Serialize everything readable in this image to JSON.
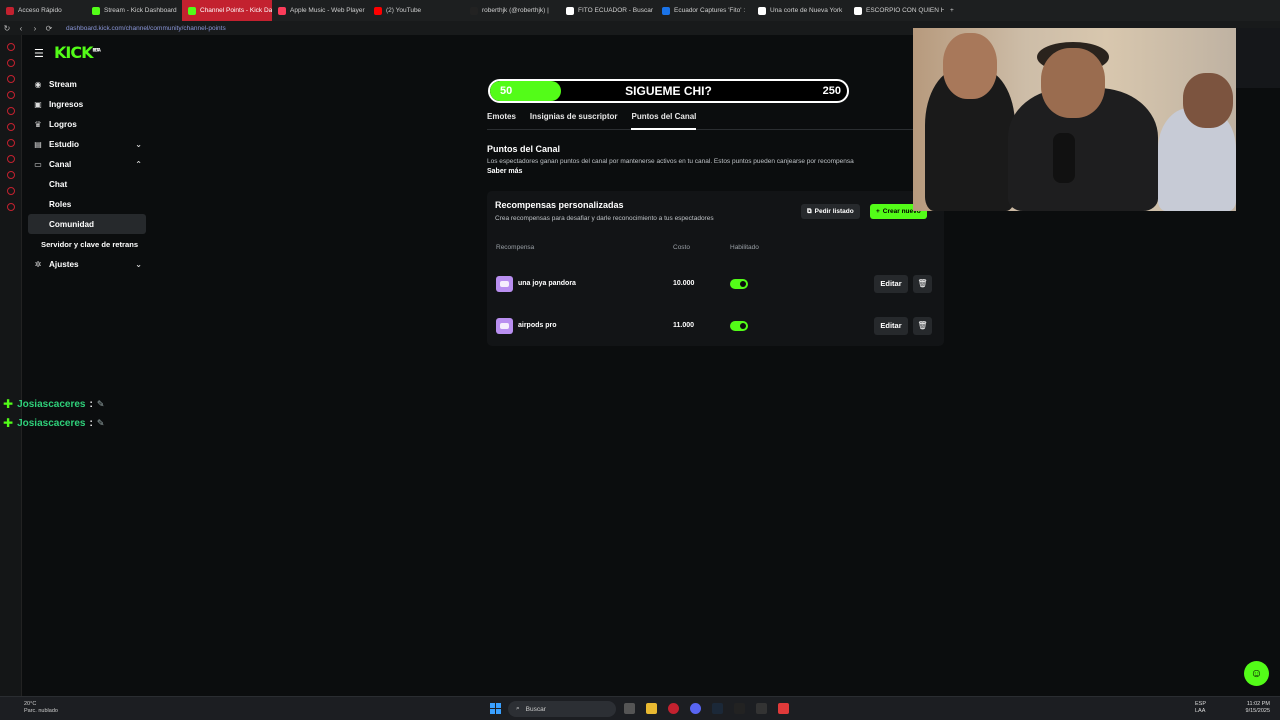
{
  "browser": {
    "tabs": [
      {
        "label": "Acceso Rápido",
        "color": "#c3212f"
      },
      {
        "label": "Stream - Kick Dashboard",
        "color": "#53fc18"
      },
      {
        "label": "Channel Points - Kick Da",
        "color": "#53fc18",
        "active": true
      },
      {
        "label": "Apple Music - Web Player",
        "color": "#fa3c5a"
      },
      {
        "label": "(2) YouTube",
        "color": "#ff0000"
      },
      {
        "label": "roberthjk (@roberthjk) |",
        "color": "#222"
      },
      {
        "label": "FITO ECUADOR - Buscar",
        "color": "#ffffff"
      },
      {
        "label": "Ecuador Captures 'Fito' :",
        "color": "#1a73e8"
      },
      {
        "label": "Una corte de Nueva York",
        "color": "#ffffff"
      },
      {
        "label": "ESCORPIO CON QUIEN H",
        "color": "#ffffff"
      }
    ],
    "url": "dashboard.kick.com/channel/community/channel-points"
  },
  "sidebar": {
    "logo": "KICK",
    "logo_badge": "BETA",
    "items": [
      {
        "label": "Stream",
        "icon": "stream-icon"
      },
      {
        "label": "Ingresos",
        "icon": "income-icon"
      },
      {
        "label": "Logros",
        "icon": "trophy-icon"
      },
      {
        "label": "Estudio",
        "icon": "studio-icon"
      },
      {
        "label": "Canal",
        "icon": "channel-icon"
      },
      {
        "label": "Chat"
      },
      {
        "label": "Roles"
      },
      {
        "label": "Comunidad"
      },
      {
        "label": "Servidor y clave de retrans"
      },
      {
        "label": "Ajustes",
        "icon": "gear-icon"
      }
    ]
  },
  "chat_overlay": [
    {
      "user": "Josiascaceres",
      "sep": ":"
    },
    {
      "user": "Josiascaceres",
      "sep": ":"
    }
  ],
  "goal": {
    "left_value": "50",
    "title": "SIGUEME CHI?",
    "right_value": "250",
    "progress": 0.2
  },
  "page": {
    "tabs": [
      "Emotes",
      "Insignias de suscriptor",
      "Puntos del Canal"
    ],
    "section_title": "Puntos del Canal",
    "section_desc": "Los espectadores ganan puntos del canal por mantenerse activos en tu canal. Estos puntos pueden canjearse por recompensa",
    "learn_more": "Saber más",
    "card": {
      "title": "Recompensas personalizadas",
      "desc": "Crea recompensas para desafiar y darle reconocimiento a tus espectadores",
      "list_button": "Pedir listado",
      "create_button": "Crear nuevo",
      "headers": {
        "reward": "Recompensa",
        "cost": "Costo",
        "enabled": "Habilitado"
      },
      "rows": [
        {
          "name": "una joya pandora",
          "cost": "10.000",
          "edit": "Editar"
        },
        {
          "name": "airpods pro",
          "cost": "11.000",
          "edit": "Editar"
        }
      ]
    }
  },
  "taskbar": {
    "weather_temp": "20°C",
    "weather_desc": "Parc. nublado",
    "search_placeholder": "Buscar",
    "lang1": "ESP",
    "lang2": "LAA",
    "time": "11:02 PM",
    "date": "9/15/2025"
  },
  "colors": {
    "accent": "#53fc18",
    "tab_active": "#c3212f"
  }
}
